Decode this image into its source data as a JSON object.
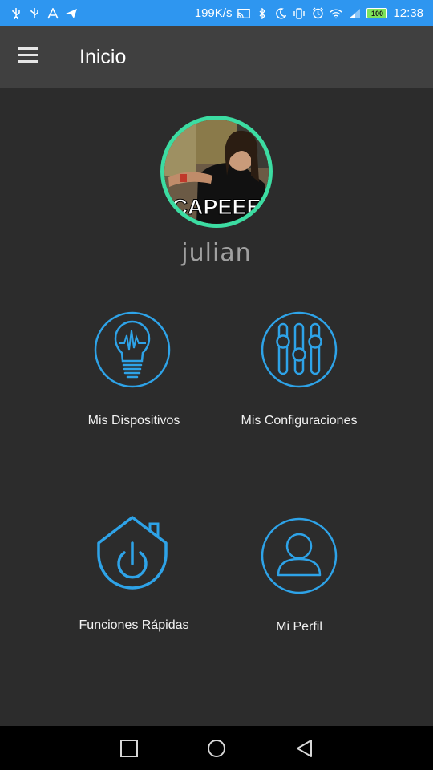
{
  "status_bar": {
    "network_speed": "199K/s",
    "battery_level": "100",
    "time": "12:38",
    "left_icons": [
      "usb-icon",
      "usb-icon",
      "font-icon",
      "send-icon"
    ],
    "right_icons": [
      "cast-icon",
      "bluetooth-icon",
      "moon-icon",
      "vibrate-icon",
      "alarm-icon",
      "wifi-icon",
      "signal-icon",
      "battery-icon"
    ]
  },
  "app_bar": {
    "title": "Inicio"
  },
  "profile": {
    "username": "julian",
    "photo_caption": "CAPEEE",
    "ring_color": "#3cdca2"
  },
  "tiles": [
    {
      "label": "Mis Dispositivos",
      "icon": "lightbulb-icon"
    },
    {
      "label": "Mis Configuraciones",
      "icon": "sliders-icon"
    },
    {
      "label": "Funciones Rápidas",
      "icon": "home-power-icon"
    },
    {
      "label": "Mi Perfil",
      "icon": "user-icon"
    }
  ],
  "colors": {
    "accent": "#2ea3e8",
    "status_bar": "#2e96f0",
    "background": "#2c2c2c",
    "app_bar": "#404040"
  }
}
